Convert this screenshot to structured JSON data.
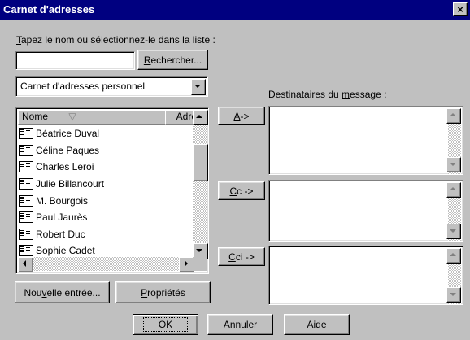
{
  "window": {
    "title": "Carnet d'adresses",
    "close_glyph": "×"
  },
  "search": {
    "prompt_pre": "",
    "prompt_mnemonic": "T",
    "prompt_post": "apez le nom ou sélectionnez-le dans la liste :",
    "input_value": "",
    "button_mnemonic": "R",
    "button_rest": "echercher..."
  },
  "address_book_select": {
    "selected": "Carnet d'adresses personnel"
  },
  "contacts_list": {
    "columns": [
      {
        "label": "Nome",
        "sort_icon": "▽"
      },
      {
        "label": "Adre"
      }
    ],
    "items": [
      "Béatrice Duval",
      "Céline Paques",
      "Charles Leroi",
      "Julie Billancourt",
      "M. Bourgois",
      "Paul Jaurès",
      "Robert Duc",
      "Sophie Cadet"
    ]
  },
  "list_buttons": {
    "new_pre": "Nou",
    "new_mnemonic": "v",
    "new_post": "elle entrée...",
    "props_mnemonic": "P",
    "props_rest": "ropriétés"
  },
  "recipients": {
    "label_pre": "Destinataires du ",
    "label_mnemonic": "m",
    "label_post": "essage :",
    "to_mnemonic": "A",
    "to_rest": " ->",
    "cc_mnemonic": "C",
    "cc_rest": "c ->",
    "bcc_mnemonic": "C",
    "bcc_rest": "ci ->"
  },
  "footer": {
    "ok_label": "OK",
    "cancel_label": "Annuler",
    "help_pre": "Ai",
    "help_mnemonic": "d",
    "help_post": "e"
  },
  "colors": {
    "titlebar": "#000080",
    "face": "#c0c0c0",
    "field": "#ffffff"
  },
  "icons": [
    "close-icon",
    "contact-card-icon",
    "sort-icon",
    "dropdown-arrow-icon",
    "scroll-up-icon",
    "scroll-down-icon",
    "scroll-left-icon",
    "scroll-right-icon"
  ]
}
